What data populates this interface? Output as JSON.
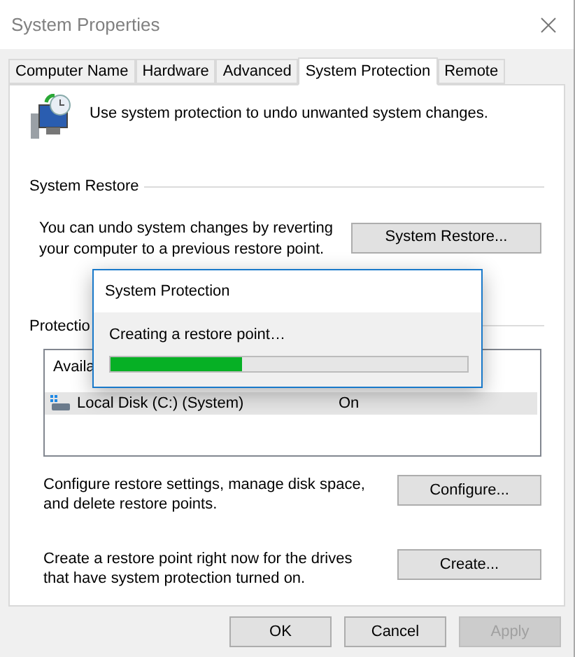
{
  "window": {
    "title": "System Properties"
  },
  "tabs": [
    {
      "label": "Computer Name",
      "selected": false
    },
    {
      "label": "Hardware",
      "selected": false
    },
    {
      "label": "Advanced",
      "selected": false
    },
    {
      "label": "System Protection",
      "selected": true
    },
    {
      "label": "Remote",
      "selected": false
    }
  ],
  "intro": "Use system protection to undo unwanted system changes.",
  "system_restore": {
    "heading": "System Restore",
    "text": "You can undo system changes by reverting your computer to a previous restore point.",
    "button": "System Restore..."
  },
  "protection_settings": {
    "heading": "Protectio",
    "columns": [
      "Availa"
    ],
    "rows": [
      {
        "drive": "Local Disk (C:) (System)",
        "protection": "On",
        "selected": true
      }
    ]
  },
  "configure": {
    "text": "Configure restore settings, manage disk space, and delete restore points.",
    "button": "Configure..."
  },
  "create": {
    "text": "Create a restore point right now for the drives that have system protection turned on.",
    "button": "Create..."
  },
  "buttons": [
    {
      "label": "OK",
      "disabled": false
    },
    {
      "label": "Cancel",
      "disabled": false
    },
    {
      "label": "Apply",
      "disabled": true
    }
  ],
  "progress_dialog": {
    "title": "System Protection",
    "message": "Creating a restore point…",
    "level": 0.37
  }
}
